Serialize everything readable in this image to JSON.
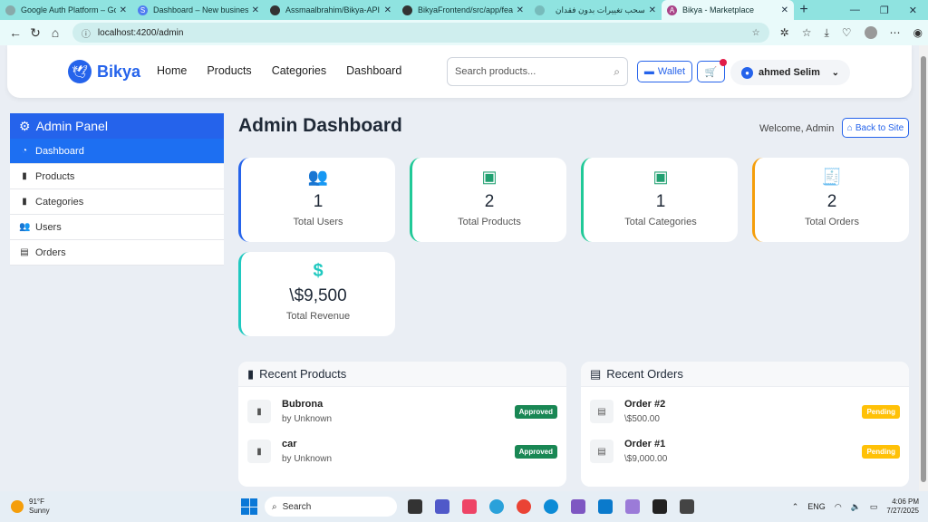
{
  "browser": {
    "tabs": [
      {
        "title": "Google Auth Platform – Goog",
        "color": "#8aa"
      },
      {
        "title": "Dashboard – New business sa",
        "color": "#4f7df0"
      },
      {
        "title": "Assmaalbrahim/Bikya-API",
        "color": "#333"
      },
      {
        "title": "BikyaFrontend/src/app/featu",
        "color": "#333"
      },
      {
        "title": "سحب تغييرات بدون فقدان",
        "color": "#7bb"
      },
      {
        "title": "Bikya - Marketplace",
        "color": "#a48"
      }
    ],
    "url": "localhost:4200/admin"
  },
  "navbar": {
    "brand": "Bikya",
    "links": [
      "Home",
      "Products",
      "Categories",
      "Dashboard"
    ],
    "search_placeholder": "Search products...",
    "wallet_label": "Wallet",
    "user_name": "ahmed Selim"
  },
  "sidebar": {
    "title": "Admin Panel",
    "items": [
      {
        "label": "Dashboard",
        "icon": "gauge-icon"
      },
      {
        "label": "Products",
        "icon": "box-icon"
      },
      {
        "label": "Categories",
        "icon": "box-icon"
      },
      {
        "label": "Users",
        "icon": "users-icon"
      },
      {
        "label": "Orders",
        "icon": "file-icon"
      }
    ]
  },
  "main": {
    "title": "Admin Dashboard",
    "welcome": "Welcome, Admin",
    "back_label": "Back to Site"
  },
  "stats": [
    {
      "value": "1",
      "label": "Total Users",
      "accent": "#2563eb",
      "icon": "users-icon"
    },
    {
      "value": "2",
      "label": "Total Products",
      "accent": "#20c997",
      "icon": "box-icon"
    },
    {
      "value": "1",
      "label": "Total Categories",
      "accent": "#20c997",
      "icon": "box-icon"
    },
    {
      "value": "2",
      "label": "Total Orders",
      "accent": "#f59e0b",
      "icon": "receipt-icon"
    },
    {
      "value": "\\$9,500",
      "label": "Total Revenue",
      "accent": "#20c9c0",
      "icon": "dollar-icon"
    }
  ],
  "recent_products": {
    "title": "Recent Products",
    "items": [
      {
        "name": "Bubrona",
        "sub": "by Unknown",
        "status": "Approved"
      },
      {
        "name": "car",
        "sub": "by Unknown",
        "status": "Approved"
      }
    ]
  },
  "recent_orders": {
    "title": "Recent Orders",
    "items": [
      {
        "name": "Order #2",
        "sub": "\\$500.00",
        "status": "Pending"
      },
      {
        "name": "Order #1",
        "sub": "\\$9,000.00",
        "status": "Pending"
      }
    ]
  },
  "taskbar": {
    "temp": "91°F",
    "condition": "Sunny",
    "search": "Search",
    "lang": "ENG",
    "time": "4:06 PM",
    "date": "7/27/2025"
  }
}
